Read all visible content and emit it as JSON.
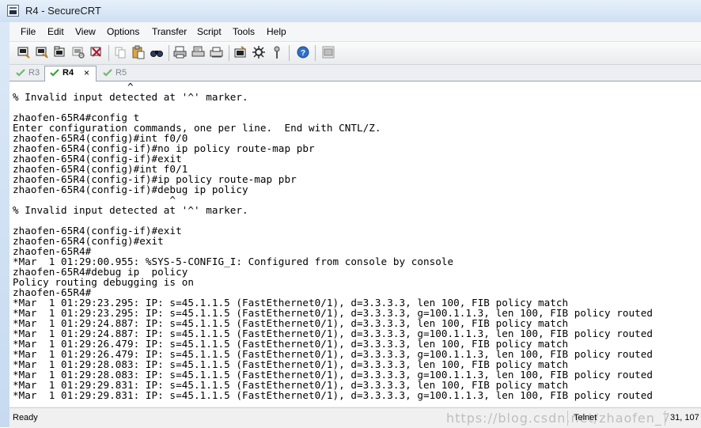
{
  "window": {
    "title": "R4 - SecureCRT"
  },
  "menu": [
    "File",
    "Edit",
    "View",
    "Options",
    "Transfer",
    "Script",
    "Tools",
    "Help"
  ],
  "toolbar": {
    "buttons": [
      "connect-icon",
      "quick-connect-icon",
      "connect-tab-icon",
      "reconnect-icon",
      "disconnect-icon",
      "copy-icon",
      "paste-icon",
      "find-icon",
      "print-icon",
      "print-selection-icon",
      "printer-setup-icon",
      "session-options-icon",
      "global-options-icon",
      "keymap-icon",
      "help-icon",
      "sftp-icon"
    ]
  },
  "tabs": [
    {
      "label": "R3",
      "active": false
    },
    {
      "label": "R4",
      "active": true,
      "close": "×"
    },
    {
      "label": "R5",
      "active": false
    }
  ],
  "terminal": {
    "lines": [
      "                   ^",
      "% Invalid input detected at '^' marker.",
      "",
      "zhaofen-65R4#config t",
      "Enter configuration commands, one per line.  End with CNTL/Z.",
      "zhaofen-65R4(config)#int f0/0",
      "zhaofen-65R4(config-if)#no ip policy route-map pbr",
      "zhaofen-65R4(config-if)#exit",
      "zhaofen-65R4(config)#int f0/1",
      "zhaofen-65R4(config-if)#ip policy route-map pbr",
      "zhaofen-65R4(config-if)#debug ip policy",
      "                          ^",
      "% Invalid input detected at '^' marker.",
      "",
      "zhaofen-65R4(config-if)#exit",
      "zhaofen-65R4(config)#exit",
      "zhaofen-65R4#",
      "*Mar  1 01:29:00.955: %SYS-5-CONFIG_I: Configured from console by console",
      "zhaofen-65R4#debug ip  policy",
      "Policy routing debugging is on",
      "zhaofen-65R4#",
      "*Mar  1 01:29:23.295: IP: s=45.1.1.5 (FastEthernet0/1), d=3.3.3.3, len 100, FIB policy match",
      "*Mar  1 01:29:23.295: IP: s=45.1.1.5 (FastEthernet0/1), d=3.3.3.3, g=100.1.1.3, len 100, FIB policy routed",
      "*Mar  1 01:29:24.887: IP: s=45.1.1.5 (FastEthernet0/1), d=3.3.3.3, len 100, FIB policy match",
      "*Mar  1 01:29:24.887: IP: s=45.1.1.5 (FastEthernet0/1), d=3.3.3.3, g=100.1.1.3, len 100, FIB policy routed",
      "*Mar  1 01:29:26.479: IP: s=45.1.1.5 (FastEthernet0/1), d=3.3.3.3, len 100, FIB policy match",
      "*Mar  1 01:29:26.479: IP: s=45.1.1.5 (FastEthernet0/1), d=3.3.3.3, g=100.1.1.3, len 100, FIB policy routed",
      "*Mar  1 01:29:28.083: IP: s=45.1.1.5 (FastEthernet0/1), d=3.3.3.3, len 100, FIB policy match",
      "*Mar  1 01:29:28.083: IP: s=45.1.1.5 (FastEthernet0/1), d=3.3.3.3, g=100.1.1.3, len 100, FIB policy routed",
      "*Mar  1 01:29:29.831: IP: s=45.1.1.5 (FastEthernet0/1), d=3.3.3.3, len 100, FIB policy match",
      "*Mar  1 01:29:29.831: IP: s=45.1.1.5 (FastEthernet0/1), d=3.3.3.3, g=100.1.1.3, len 100, FIB policy routed"
    ]
  },
  "status": {
    "ready": "Ready",
    "protocol": "Telnet",
    "position": "31, 107",
    "watermark": "https://blog.csdn.net/zhaofen_7"
  },
  "colors": {
    "accent": "#2f7fd0",
    "check": "#3aa33a",
    "frame": "#cfe0f3"
  }
}
